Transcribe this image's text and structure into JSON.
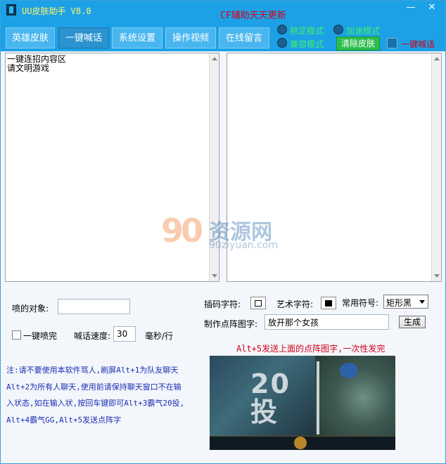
{
  "window": {
    "title": "UU皮肤助手 V8.0",
    "promo": "CF辅助天天更新",
    "minimize_symbol": "—",
    "close_symbol": "✕"
  },
  "tabs": [
    {
      "label": "英雄皮肤",
      "active": false
    },
    {
      "label": "一键喊话",
      "active": true
    },
    {
      "label": "系统设置",
      "active": false
    },
    {
      "label": "操作视频",
      "active": false
    },
    {
      "label": "在线留言",
      "active": false
    }
  ],
  "modes": {
    "radio1": "稳定模式",
    "radio2": "加速模式",
    "radio3": "兼容模式",
    "clear_skin_button": "清除皮肤",
    "quick_shout_checkbox": "一键喊话"
  },
  "left_pane": {
    "lines": [
      "一键连招内容区",
      "请文明游戏"
    ]
  },
  "watermark": {
    "number": "90",
    "name": "资源网",
    "url": "90ziyuan.com"
  },
  "controls": {
    "target_label": "喷的对象:",
    "target_value": "",
    "spray_complete_label": "一键喷完",
    "speed_label": "喊话速度:",
    "speed_value": "30",
    "speed_unit": "毫秒/行",
    "mosaic_label": "插码字符:",
    "art_label": "艺术字符:",
    "common_symbol_label": "常用符号:",
    "common_symbol_value": "矩形黑",
    "matrix_label": "制作点阵图字:",
    "matrix_value": "放开那个女孩",
    "generate_button": "生成"
  },
  "hint_red": "Alt+5发送上面的点阵图字,一次性发完",
  "note_lines": [
    "注:请不要使用本软件骂人,刷屏Alt+1为队友聊天",
    "Alt+2为所有人聊天,使用前请保持聊天窗口不在输",
    "入状态,如在输入状,按回车键即可Alt+3霸气20投,",
    "Alt+4霸气GG,Alt+5发送点阵字"
  ],
  "preview": {
    "text_line1": "20",
    "text_line2": "投"
  }
}
